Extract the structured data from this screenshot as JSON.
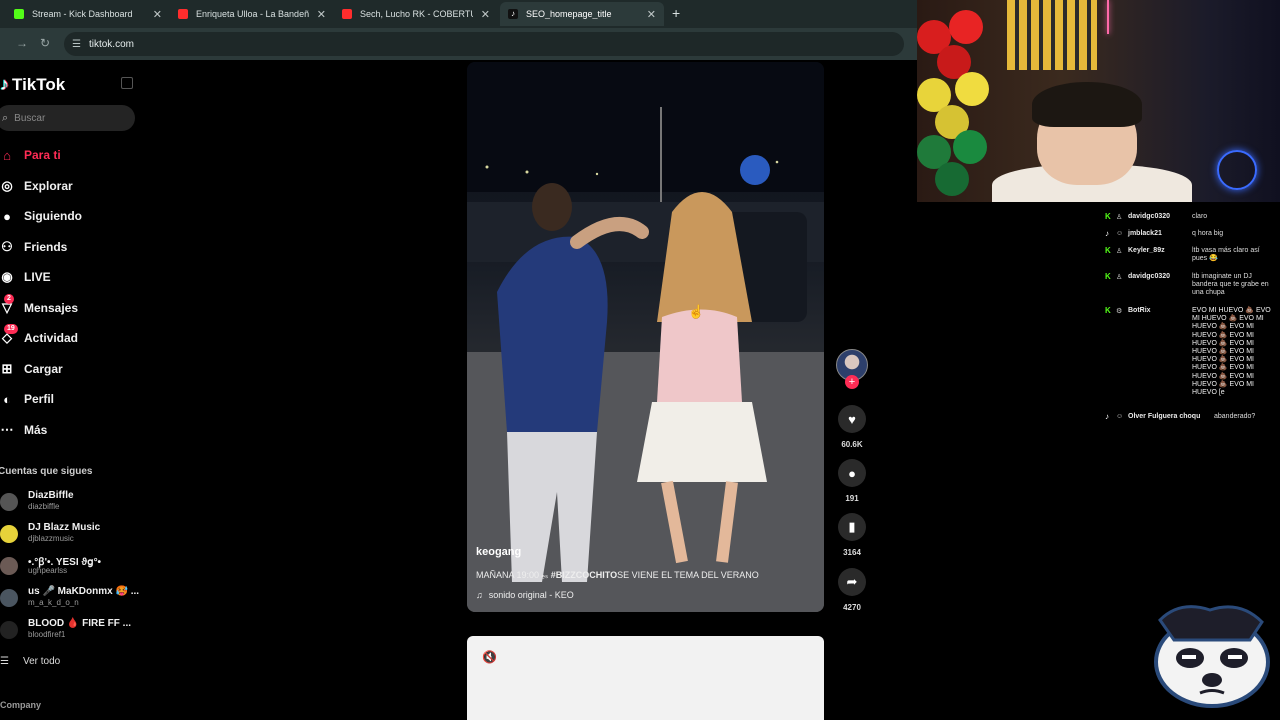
{
  "browser": {
    "tabs": [
      {
        "label": "Stream - Kick Dashboard",
        "favicon_color": "#53fc18"
      },
      {
        "label": "Enriqueta Ulloa - La Bandeñita",
        "favicon_color": "#ff2d2d"
      },
      {
        "label": "Sech, Lucho RK - COBERTURA (",
        "favicon_color": "#ff2d2d"
      },
      {
        "label": "SEO_homepage_title",
        "favicon_color": "#ffffff"
      }
    ],
    "url": "tiktok.com"
  },
  "sidebar": {
    "logo": "TikTok",
    "search_placeholder": "Buscar",
    "nav": [
      {
        "label": "Para ti",
        "icon": "home-icon",
        "active": true
      },
      {
        "label": "Explorar",
        "icon": "compass-icon"
      },
      {
        "label": "Siguiendo",
        "icon": "following-icon"
      },
      {
        "label": "Friends",
        "icon": "friends-icon"
      },
      {
        "label": "LIVE",
        "icon": "live-icon"
      },
      {
        "label": "Mensajes",
        "icon": "messages-icon",
        "badge": "2"
      },
      {
        "label": "Actividad",
        "icon": "activity-icon",
        "badge": "19"
      },
      {
        "label": "Cargar",
        "icon": "upload-icon"
      },
      {
        "label": "Perfil",
        "icon": "profile-icon"
      },
      {
        "label": "Más",
        "icon": "more-icon"
      }
    ],
    "following_title": "Cuentas que sigues",
    "following": [
      {
        "name": "DiazBiffle",
        "handle": "diazbiffle"
      },
      {
        "name": "DJ Blazz Music",
        "handle": "djblazzmusic"
      },
      {
        "name": "•.°ꞵ'•. YESI ϑց°•",
        "handle": "ughpearlss"
      },
      {
        "name": "us 🎤 MaKDonmx 🥵 ...",
        "handle": "m_a_k_d_o_n"
      },
      {
        "name": "BLOOD 🩸 FIRE FF ...",
        "handle": "bloodfiref1"
      }
    ],
    "see_all": "Ver todo",
    "footer": "Company"
  },
  "video": {
    "author": "keogang",
    "caption_prefix": "MAÑANA 19:00 ₑₛ ",
    "caption_hashtag": "#BIZZCOCHITO",
    "caption_suffix": "SE VIENE EL TEMA DEL VERANO",
    "music": "sonido original - KEO",
    "likes": "60.6K",
    "comments": "191",
    "saves": "3164",
    "shares": "4270"
  },
  "chat": [
    {
      "user": "davidgc0320",
      "text": "claro",
      "platform": "kick"
    },
    {
      "user": "jmblack21",
      "text": "q hora big",
      "platform": "tiktok"
    },
    {
      "user": "Keyler_89z",
      "text": "ltb vasa más claro así pues 😂",
      "platform": "kick"
    },
    {
      "user": "davidgc0320",
      "text": "ltb imaginate un DJ bandera que te grabe en una chupa",
      "platform": "kick"
    },
    {
      "user": "BotRix",
      "text": "EVO MI HUEVO 💩 EVO MI HUEVO 💩 EVO MI HUEVO 💩 EVO MI HUEVO 💩 EVO MI HUEVO 💩 EVO MI HUEVO 💩 EVO MI HUEVO 💩 EVO MI HUEVO 💩 EVO MI HUEVO 💩 EVO MI HUEVO 💩 EVO MI HUEVO [e",
      "platform": "kick"
    },
    {
      "user": "Olver Fulguera choqu",
      "text": "abanderado?",
      "platform": "tiktok"
    }
  ],
  "colors": {
    "accent": "#fe2c55",
    "kick": "#53fc18",
    "teal": "#25f4ee"
  }
}
